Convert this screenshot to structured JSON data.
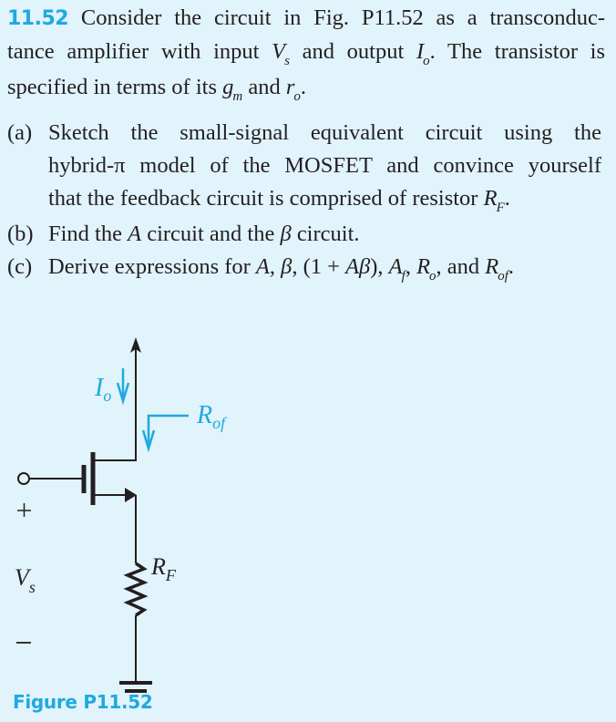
{
  "problem": {
    "number": "11.52",
    "line1_text": "Consider the circuit in Fig. P11.52 as a transconduc-",
    "line2_a": "tance amplifier with input ",
    "line2_var1": "V",
    "line2_var1_sub": "s",
    "line2_b": " and output ",
    "line2_var2": "I",
    "line2_var2_sub": "o",
    "line2_c": ". The transistor is",
    "line3_a": "specified in terms of its ",
    "line3_var1": "g",
    "line3_var1_sub": "m",
    "line3_b": " and ",
    "line3_var2": "r",
    "line3_var2_sub": "o",
    "line3_c": "."
  },
  "parts": [
    {
      "label": "(a)",
      "line1": "Sketch the small-signal equivalent circuit using the",
      "line2": "hybrid-π model of the MOSFET and convince yourself",
      "line3_a": "that the feedback circuit is comprised of resistor ",
      "line3_var": "R",
      "line3_sub": "F",
      "line3_end": "."
    },
    {
      "label": "(b)",
      "text_a": "Find the ",
      "var_a": "A",
      "text_b": " circuit and the ",
      "var_b": "β",
      "text_c": " circuit."
    },
    {
      "label": "(c)",
      "text_a": "Derive expressions for ",
      "expr1": "A",
      "sep1": ", ",
      "expr2": "β",
      "sep2": ", (1 + ",
      "expr3": "Aβ",
      "sep3": "), ",
      "expr4": "A",
      "expr4_sub": "f",
      "sep4": ", ",
      "expr5": "R",
      "expr5_sub": "o",
      "sep5": ", and ",
      "expr6": "R",
      "expr6_sub": "of",
      "end": "."
    }
  ],
  "figure": {
    "labels": {
      "io_main": "I",
      "io_sub": "o",
      "rof_main": "R",
      "rof_sub": "of",
      "rf_main": "R",
      "rf_sub": "F",
      "vs_main": "V",
      "vs_sub": "s",
      "plus": "+",
      "minus": "−"
    },
    "caption": "Figure P11.52"
  },
  "colors": {
    "background": "#e1f3fb",
    "accent": "#1fa9e1",
    "text": "#231f20"
  }
}
